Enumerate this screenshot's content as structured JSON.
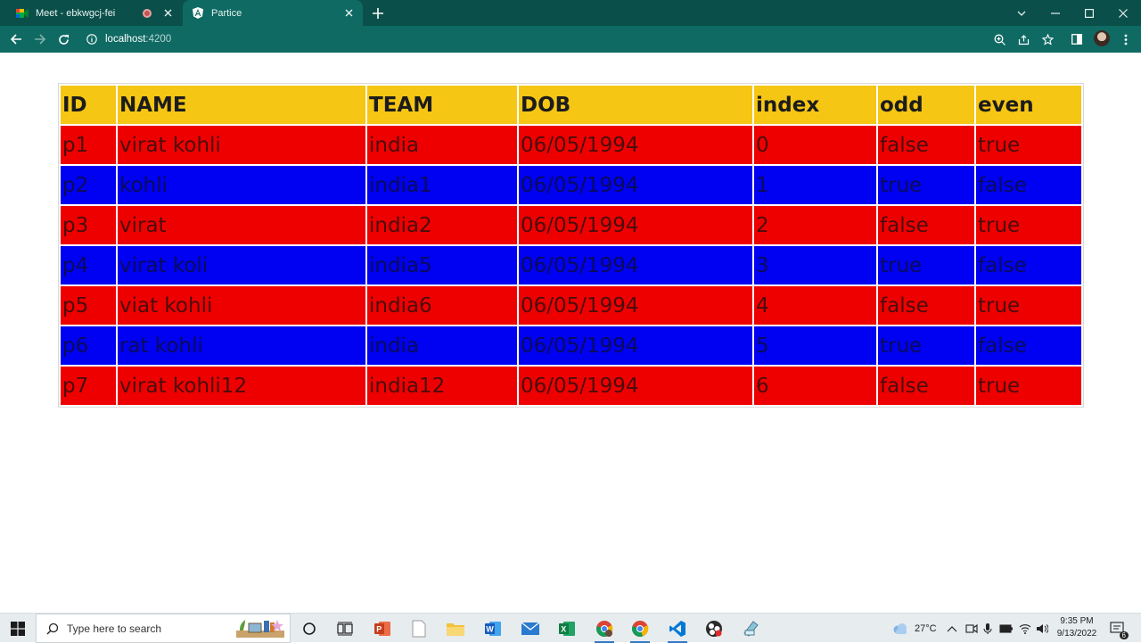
{
  "browser": {
    "tabs": [
      {
        "title": "Meet - ebkwgcj-fei",
        "favicon": "google-meet-icon",
        "recording": true
      },
      {
        "title": "Partice",
        "favicon": "angular-icon"
      }
    ],
    "url_host": "localhost",
    "url_port": ":4200"
  },
  "table": {
    "headers": [
      "ID",
      "NAME",
      "TEAM",
      "DOB",
      "index",
      "odd",
      "even"
    ],
    "rows": [
      [
        "p1",
        "virat kohli",
        "india",
        "06/05/1994",
        "0",
        "false",
        "true"
      ],
      [
        "p2",
        "kohli",
        "india1",
        "06/05/1994",
        "1",
        "true",
        "false"
      ],
      [
        "p3",
        "virat",
        "india2",
        "06/05/1994",
        "2",
        "false",
        "true"
      ],
      [
        "p4",
        "virat koli",
        "india5",
        "06/05/1994",
        "3",
        "true",
        "false"
      ],
      [
        "p5",
        "viat kohli",
        "india6",
        "06/05/1994",
        "4",
        "false",
        "true"
      ],
      [
        "p6",
        "rat kohli",
        "india",
        "06/05/1994",
        "5",
        "true",
        "false"
      ],
      [
        "p7",
        "virat kohli12",
        "india12",
        "06/05/1994",
        "6",
        "false",
        "true"
      ]
    ],
    "colors": {
      "header": "#f6c614",
      "even_row": "#ef0000",
      "odd_row": "#0000f2"
    }
  },
  "taskbar": {
    "search_placeholder": "Type here to search",
    "temperature": "27°C",
    "time": "9:35 PM",
    "date": "9/13/2022",
    "notification_count": "6"
  }
}
